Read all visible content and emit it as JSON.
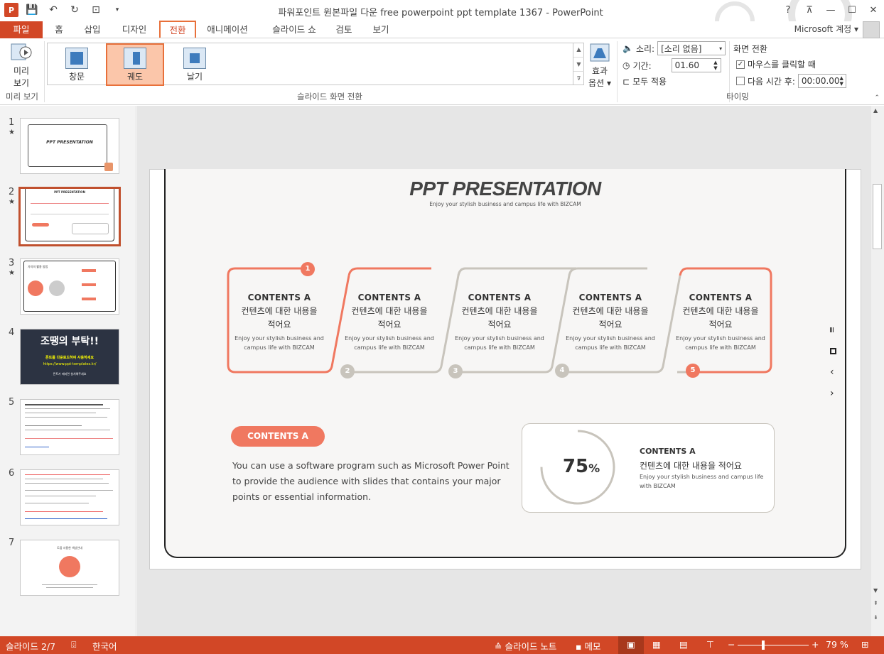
{
  "app": {
    "title": "파워포인트 원본파일 다운 free powerpoint ppt template 1367 - PowerPoint",
    "logo": "P",
    "account": "Microsoft 계정",
    "help": "?"
  },
  "colors": {
    "accent": "#d24726",
    "highlight": "#e8703a",
    "slide_orange": "#f07860",
    "slide_gray": "#c8c4bc"
  },
  "tabs": [
    {
      "label": "파일"
    },
    {
      "label": "홈"
    },
    {
      "label": "삽입"
    },
    {
      "label": "디자인"
    },
    {
      "label": "전환"
    },
    {
      "label": "애니메이션"
    },
    {
      "label": "슬라이드 쇼"
    },
    {
      "label": "검토"
    },
    {
      "label": "보기"
    }
  ],
  "ribbon": {
    "preview": {
      "label1": "미리",
      "label2": "보기",
      "group": "미리 보기"
    },
    "gallery": {
      "items": [
        "창문",
        "궤도",
        "날기"
      ],
      "selected": "궤도",
      "group": "슬라이드 화면 전환"
    },
    "effect_options": {
      "label1": "효과",
      "label2": "옵션"
    },
    "timing": {
      "sound_label": "소리:",
      "sound_value": "[소리 없음]",
      "duration_label": "기간:",
      "duration_value": "01.60",
      "apply_all": "모두 적용",
      "advance_title": "화면 전환",
      "on_click": "마우스를 클릭할 때",
      "on_click_checked": true,
      "after_label": "다음 시간 후:",
      "after_value": "00:00.00",
      "after_checked": false,
      "group": "타이밍"
    }
  },
  "thumbnails": [
    {
      "num": "1",
      "star": "★",
      "text": "PPT PRESENTATION"
    },
    {
      "num": "2",
      "star": "★",
      "text": "PPT PRESENTATION"
    },
    {
      "num": "3",
      "star": "★",
      "text": "가치의 활용 방법"
    },
    {
      "num": "4",
      "star": "",
      "text": "조땡의 부탁!!",
      "sub1": "폰트를 다운로드하여 사용하세요",
      "sub2": "https://www.ppt-templates.kr/",
      "sub3": "폰트가 깨지면 설치해주세요"
    },
    {
      "num": "5",
      "star": "",
      "text": ""
    },
    {
      "num": "6",
      "star": "",
      "text": ""
    },
    {
      "num": "7",
      "star": "",
      "text": "도움 사용한 색상안내"
    }
  ],
  "slide": {
    "title": "PPT PRESENTATION",
    "subtitle": "Enjoy your stylish business and campus life with BIZCAM",
    "cards": [
      {
        "num": "1",
        "title": "CONTENTS A",
        "kr1": "컨텐츠에 대한 내용을",
        "kr2": "적어요",
        "en1": "Enjoy your stylish business and",
        "en2": "campus life with BIZCAM"
      },
      {
        "num": "2",
        "title": "CONTENTS A",
        "kr1": "컨텐츠에 대한 내용을",
        "kr2": "적어요",
        "en1": "Enjoy your stylish business and",
        "en2": "campus life with BIZCAM"
      },
      {
        "num": "3",
        "title": "CONTENTS A",
        "kr1": "컨텐츠에 대한 내용을",
        "kr2": "적어요",
        "en1": "Enjoy your stylish business and",
        "en2": "campus life with BIZCAM"
      },
      {
        "num": "4",
        "title": "CONTENTS A",
        "kr1": "컨텐츠에 대한 내용을",
        "kr2": "적어요",
        "en1": "Enjoy your stylish business and",
        "en2": "campus life with BIZCAM"
      },
      {
        "num": "5",
        "title": "CONTENTS A",
        "kr1": "컨텐츠에 대한 내용을",
        "kr2": "적어요",
        "en1": "Enjoy your stylish business and",
        "en2": "campus life with BIZCAM"
      }
    ],
    "pill": "CONTENTS A",
    "body1": "You can use a software program such as Microsoft Power Point",
    "body2": "to provide the audience with slides that contains your major",
    "body3": "points or essential information.",
    "stat": {
      "value": "75",
      "unit": "%",
      "fraction": 0.75,
      "title": "CONTENTS A",
      "kr": "컨텐츠에 대한 내용을 적어요",
      "en1": "Enjoy your stylish business and campus life",
      "en2": "with BIZCAM"
    }
  },
  "status": {
    "slide_info": "슬라이드 2/7",
    "language": "한국어",
    "notes": "슬라이드 노트",
    "comments": "메모",
    "zoom": "79 %"
  }
}
